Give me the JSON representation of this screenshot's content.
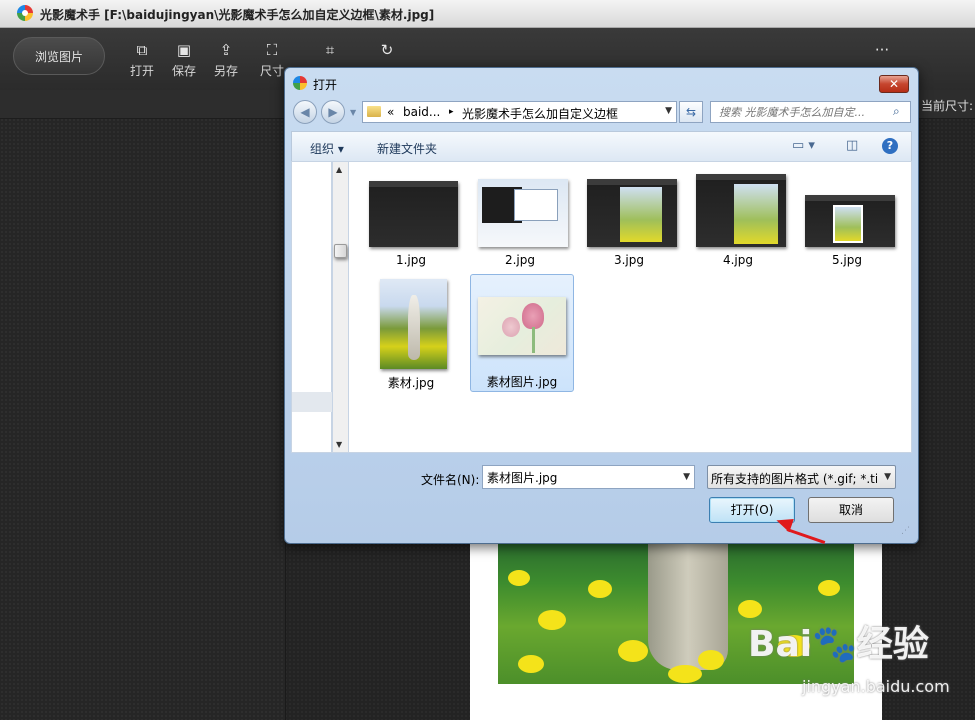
{
  "app": {
    "title": "光影魔术手 [F:\\baidujingyan\\光影魔术手怎么加自定义边框\\素材.jpg]",
    "browse_label": "浏览图片",
    "tools": [
      {
        "label": "打开",
        "icon": "open-icon"
      },
      {
        "label": "保存",
        "icon": "save-icon"
      },
      {
        "label": "另存",
        "icon": "save-as-icon"
      },
      {
        "label": "尺寸",
        "icon": "resize-icon"
      },
      {
        "label": "",
        "icon": "crop-icon"
      },
      {
        "label": "",
        "icon": "rotate-icon"
      }
    ],
    "more_icon": "ellipsis-icon",
    "size_info": "当前尺寸:"
  },
  "dialog": {
    "title": "打开",
    "close_label": "✕",
    "breadcrumb": [
      "«",
      "baid...",
      "▸",
      "光影魔术手怎么加自定义边框"
    ],
    "search_placeholder": "搜索 光影魔术手怎么加自定...",
    "commands": {
      "organize": "组织 ▾",
      "new_folder": "新建文件夹"
    },
    "files": [
      {
        "name": "1.jpg",
        "kind": "dark"
      },
      {
        "name": "2.jpg",
        "kind": "window"
      },
      {
        "name": "3.jpg",
        "kind": "dark-photo"
      },
      {
        "name": "4.jpg",
        "kind": "dark-photo"
      },
      {
        "name": "5.jpg",
        "kind": "dark-small"
      },
      {
        "name": "素材.jpg",
        "kind": "photo"
      },
      {
        "name": "素材图片.jpg",
        "kind": "tulip",
        "selected": true
      }
    ],
    "filename_label": "文件名(N):",
    "filename_value": "素材图片.jpg",
    "filetype_value": "所有支持的图片格式 (*.gif; *.tif",
    "open_button": "打开(O)",
    "cancel_button": "取消"
  },
  "watermark": {
    "main": "Bai🐾经验",
    "sub": "jingyan.baidu.com"
  },
  "colors": {
    "accent": "#3c7fb1",
    "arrow": "#e0191c",
    "dark_bg": "#242424"
  }
}
